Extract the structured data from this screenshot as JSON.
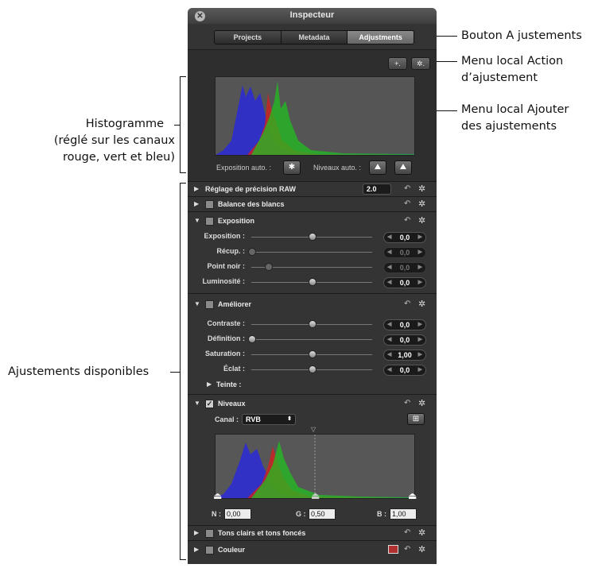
{
  "annotations": {
    "adjustments_button": "Bouton A justements",
    "action_menu_line1": "Menu local Action",
    "action_menu_line2": "d’ajustement",
    "add_menu_line1": "Menu local Ajouter",
    "add_menu_line2": "des ajustements",
    "histogram_line1": "Histogramme",
    "histogram_line2": "(réglé sur les canaux",
    "histogram_line3": "rouge, vert et bleu)",
    "available": "Ajustements disponibles"
  },
  "window": {
    "title": "Inspecteur",
    "close": "✕"
  },
  "tabs": [
    {
      "label": "Projects"
    },
    {
      "label": "Metadata"
    },
    {
      "label": "Adjustments"
    }
  ],
  "toolbar": {
    "add_label": "+.",
    "action_label": "✲."
  },
  "histogram": {
    "auto_exposure_label": "Exposition auto. :",
    "auto_levels_label": "Niveaux auto. :"
  },
  "raw": {
    "title": "Réglage de précision RAW",
    "version": "2.0"
  },
  "white_balance": {
    "title": "Balance des blancs"
  },
  "exposure": {
    "title": "Exposition",
    "params": [
      {
        "label": "Exposition :",
        "value": "0,0",
        "level": 0.5
      },
      {
        "label": "Récup. :",
        "value": "0,0",
        "level": 0.0
      },
      {
        "label": "Point noir :",
        "value": "0,0",
        "level": 0.14
      },
      {
        "label": "Luminosité :",
        "value": "0,0",
        "level": 0.5
      }
    ]
  },
  "enhance": {
    "title": "Améliorer",
    "params": [
      {
        "label": "Contraste :",
        "value": "0,0",
        "level": 0.5
      },
      {
        "label": "Définition :",
        "value": "0,0",
        "level": 0.0
      },
      {
        "label": "Saturation :",
        "value": "1,00",
        "level": 0.5
      },
      {
        "label": "Éclat :",
        "value": "0,0",
        "level": 0.5
      }
    ],
    "tint_label": "Teinte :"
  },
  "levels": {
    "title": "Niveaux",
    "channel_label": "Canal :",
    "channel_value": "RVB",
    "black_label": "N :",
    "black_value": "0,00",
    "gray_label": "G :",
    "gray_value": "0,50",
    "white_label": "B :",
    "white_value": "1,00"
  },
  "highlights": {
    "title": "Tons clairs et tons foncés"
  },
  "color": {
    "title": "Couleur"
  },
  "colors": {
    "red": "#d02020",
    "green": "#20c020",
    "blue": "#2a2ad8",
    "panel": "#343434"
  }
}
